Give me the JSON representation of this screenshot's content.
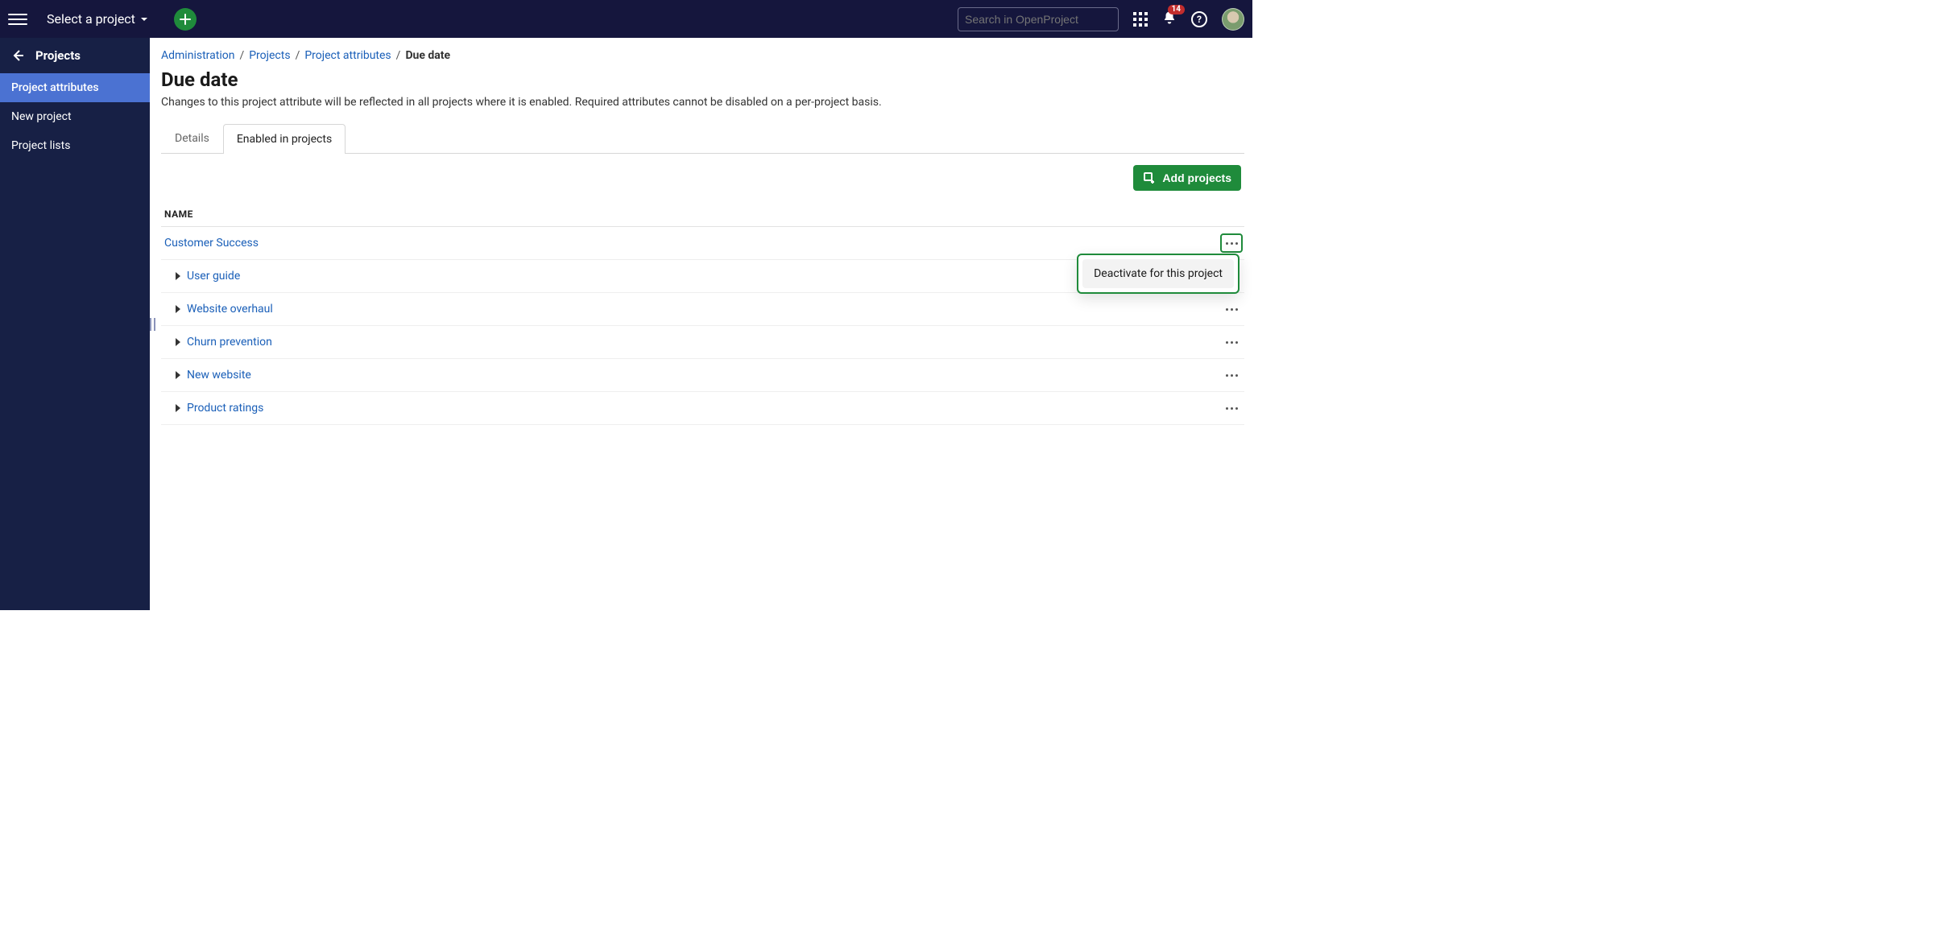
{
  "topbar": {
    "project_selector_label": "Select a project",
    "search_placeholder": "Search in OpenProject",
    "notification_count": "14"
  },
  "sidebar": {
    "back_label": "Projects",
    "items": [
      {
        "label": "Project attributes",
        "active": true
      },
      {
        "label": "New project",
        "active": false
      },
      {
        "label": "Project lists",
        "active": false
      }
    ]
  },
  "breadcrumb": {
    "parts": [
      "Administration",
      "Projects",
      "Project attributes"
    ],
    "current": "Due date"
  },
  "page": {
    "title": "Due date",
    "description": "Changes to this project attribute will be reflected in all projects where it is enabled. Required attributes cannot be disabled on a per-project basis."
  },
  "tabs": {
    "items": [
      {
        "label": "Details",
        "active": false
      },
      {
        "label": "Enabled in projects",
        "active": true
      }
    ]
  },
  "toolbar": {
    "add_projects_label": "Add projects"
  },
  "list": {
    "header": "NAME",
    "rows": [
      {
        "label": "Customer Success",
        "level": 0
      },
      {
        "label": "User guide",
        "level": 1
      },
      {
        "label": "Website overhaul",
        "level": 1
      },
      {
        "label": "Churn prevention",
        "level": 1
      },
      {
        "label": "New website",
        "level": 1
      },
      {
        "label": "Product ratings",
        "level": 1
      }
    ]
  },
  "context_menu": {
    "item_label": "Deactivate for this project"
  }
}
